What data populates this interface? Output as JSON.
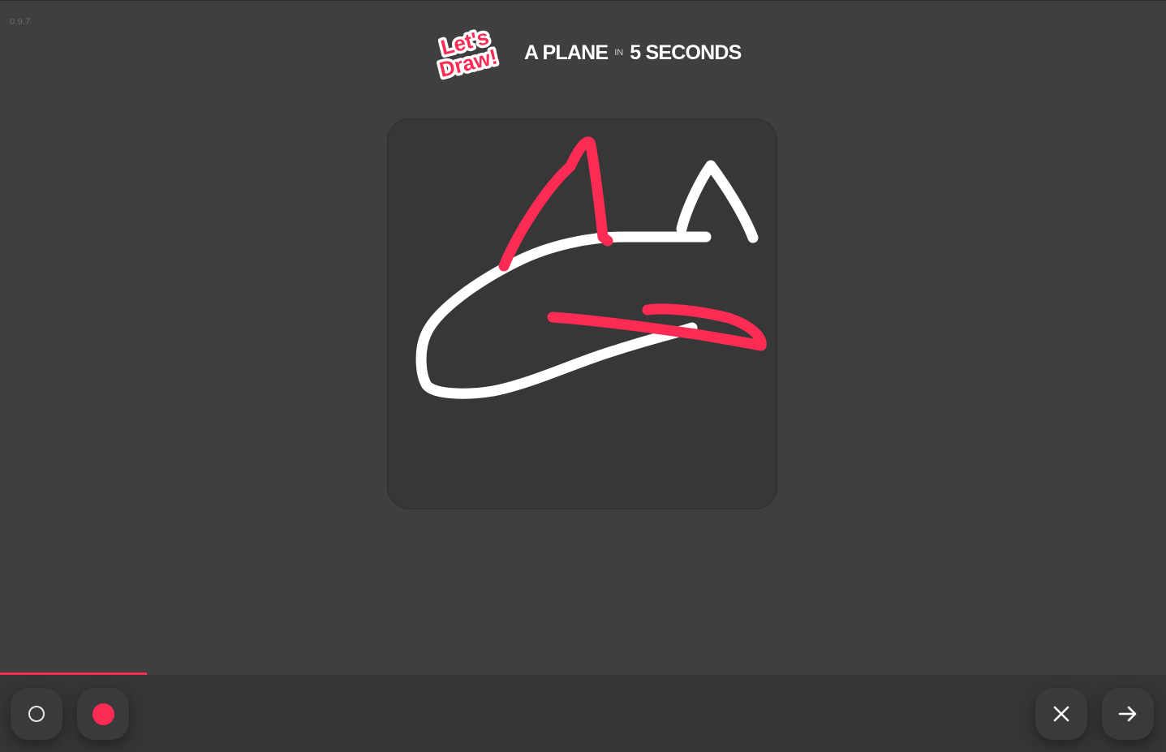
{
  "app": {
    "version": "0.9.7",
    "logo_text": [
      "Let's",
      "Draw!"
    ]
  },
  "header": {
    "subject": "A PLANE",
    "connector": "IN",
    "duration": "5 SECONDS"
  },
  "colors": {
    "background": "#3f3f3f",
    "canvas": "#373737",
    "toolbar": "#353535",
    "accent": "#fe2c55",
    "ink_white": "#ffffff",
    "ink_red": "#fe2c55"
  },
  "timer": {
    "progress_fraction": 0.126
  },
  "toolbar": {
    "left_tools": [
      {
        "name": "white-ink",
        "icon": "hollow-circle-icon",
        "color": "#ffffff"
      },
      {
        "name": "red-ink",
        "icon": "filled-circle-icon",
        "color": "#fe2c55"
      }
    ],
    "right_tools": [
      {
        "name": "clear",
        "icon": "close-icon"
      },
      {
        "name": "next",
        "icon": "arrow-right-icon"
      }
    ]
  }
}
